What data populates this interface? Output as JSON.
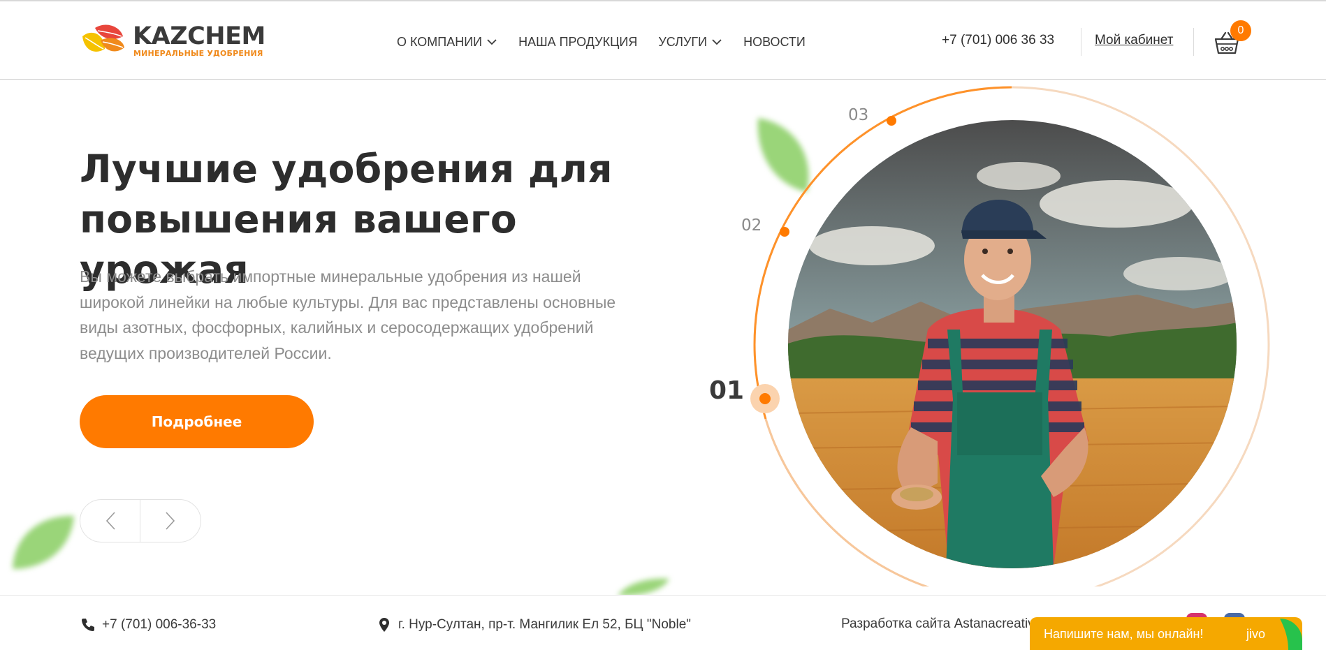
{
  "brand": {
    "name": "KAZCHEM",
    "tagline": "МИНЕРАЛЬНЫЕ УДОБРЕНИЯ",
    "colors": {
      "orange": "#ff7a00",
      "yellow": "#f5c200",
      "red": "#e8463c",
      "text": "#2d2d2d"
    }
  },
  "nav": {
    "items": [
      {
        "label": "О КОМПАНИИ",
        "has_dropdown": true
      },
      {
        "label": "НАША ПРОДУКЦИЯ",
        "has_dropdown": false
      },
      {
        "label": "УСЛУГИ",
        "has_dropdown": true
      },
      {
        "label": "НОВОСТИ",
        "has_dropdown": false
      }
    ]
  },
  "header": {
    "phone": "+7 (701) 006 36 33",
    "cabinet_label": "Мой кабинет",
    "cart_count": "0",
    "cart_icon": "basket-icon"
  },
  "hero": {
    "title": "Лучшие удобрения для повышения вашего урожая",
    "text": "Вы можете выбрать импортные минеральные удобрения из нашей широкой линейки на любые культуры. Для вас представлены основные виды азотных, фосфорных, калийных и серосодержащих удобрений ведущих производителей России.",
    "button_label": "Подробнее",
    "prev_icon": "chevron-left-icon",
    "next_icon": "chevron-right-icon"
  },
  "slides": {
    "steps": [
      "01",
      "02",
      "03"
    ],
    "active": "01"
  },
  "footer": {
    "phone": "+7 (701) 006-36-33",
    "address": "г. Нур-Султан, пр-т. Мангилик Ел 52, БЦ \"Noble\"",
    "developer": "Разработка сайта Astanacreativ"
  },
  "chat": {
    "label": "Напишите нам, мы онлайн!",
    "brand": "jivo"
  }
}
